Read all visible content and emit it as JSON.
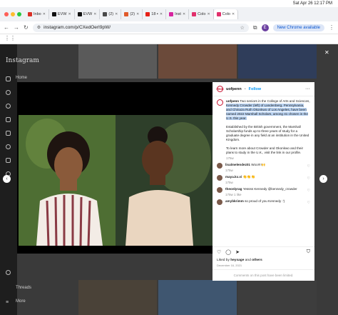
{
  "menubar": {
    "date_time": "Sat Apr 26  12:17 PM"
  },
  "tabs": [
    {
      "label": "Inbo",
      "color": "#d93025"
    },
    {
      "label": "EVW",
      "color": "#111111"
    },
    {
      "label": "EVW",
      "color": "#111111"
    },
    {
      "label": "(2)",
      "color": "#4a4a4a"
    },
    {
      "label": "(2)",
      "color": "#e05a2b"
    },
    {
      "label": "18 ▪",
      "color": "#e62117"
    },
    {
      "label": "Inst",
      "color": "#d6249f"
    },
    {
      "label": "Colo",
      "color": "#e1306c"
    },
    {
      "label": "Colo",
      "color": "#e1306c"
    }
  ],
  "address": {
    "url": "instagram.com/p/CXedOerI9pW/",
    "new_chrome": "New Chrome available",
    "profile_initial": "E"
  },
  "sidebar": {
    "logo": "Instagram",
    "home": "Home",
    "threads": "Threads",
    "more": "More"
  },
  "post": {
    "username": "uofpenn",
    "follow": "Follow",
    "avatar_text": "PENN",
    "caption_pre": "Two seniors in the College of Arts and Sciences, ",
    "caption_hl": "Kennedy Crowder (left) of Landenberg, Pennsylvania, and Chinaza Ruth Okonkwo of Los Angeles, have been named 2022 Marshall Scholars, among 41 chosen in the U.S. this year.",
    "caption_p2": "Established by the British government, the Marshall Scholarship funds up to three years of study for a graduate degree in any field at an institution in the United Kingdom.",
    "caption_p3": "To learn more about Crowder and Okonkwo and their plans to study in the U.K., visit the link in our profile.",
    "caption_time": "175w",
    "comments": [
      {
        "user": "lisalmelendez01",
        "text": "Woo!!!!🙌",
        "meta": "175w"
      },
      {
        "user": "maya.kx.vi",
        "text": "👏👏👏",
        "meta": "175w"
      },
      {
        "user": "theonlyrag",
        "text": "Yessss Kennedy @kennedy_crowder",
        "meta": "175w   1 like"
      },
      {
        "user": "amybkrimm",
        "text": "so proud of you Kennedy :')",
        "meta": ""
      }
    ],
    "liked_by_pre": "Liked by ",
    "liked_by_user": "heysage",
    "liked_by_and": " and ",
    "liked_by_others": "others",
    "date": "December 16, 2021",
    "comments_limited": "Comments on this post have been limited."
  }
}
